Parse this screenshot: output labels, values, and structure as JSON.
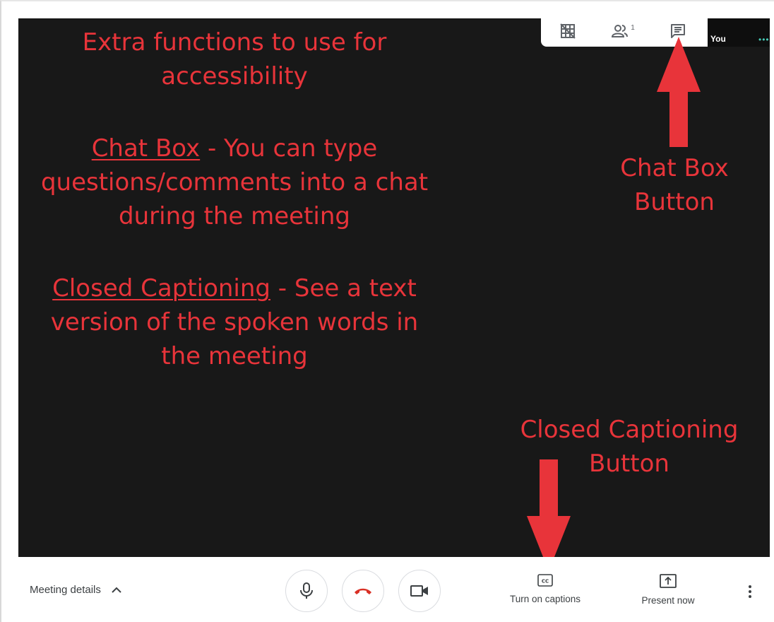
{
  "annotations": {
    "heading": [
      "Extra functions to use for",
      "accessibility"
    ],
    "chat_term": "Chat Box",
    "chat_desc_line1": " - You can type",
    "chat_desc_lines": [
      "questions/comments into a chat",
      "during the meeting"
    ],
    "cc_term": "Closed Captioning",
    "cc_desc_line1": " - See a text",
    "cc_desc_lines": [
      "version of the spoken words in",
      "the meeting"
    ],
    "chat_button_callout": [
      "Chat Box",
      "Button"
    ],
    "cc_button_callout": [
      "Closed Captioning",
      "Button"
    ]
  },
  "self_tile": {
    "label": "You",
    "indicator": "•••"
  },
  "top_toolbar": {
    "icons": [
      "tile-layout-off-icon",
      "people-icon",
      "chat-icon"
    ],
    "participant_count": "1"
  },
  "bottom_bar": {
    "meeting_details_label": "Meeting details",
    "captions_label": "Turn on captions",
    "present_label": "Present now"
  },
  "colors": {
    "annotation_red": "#e8343a",
    "stage_bg": "#181818",
    "hangup_red": "#d93025",
    "self_indicator": "#46c9b5"
  }
}
